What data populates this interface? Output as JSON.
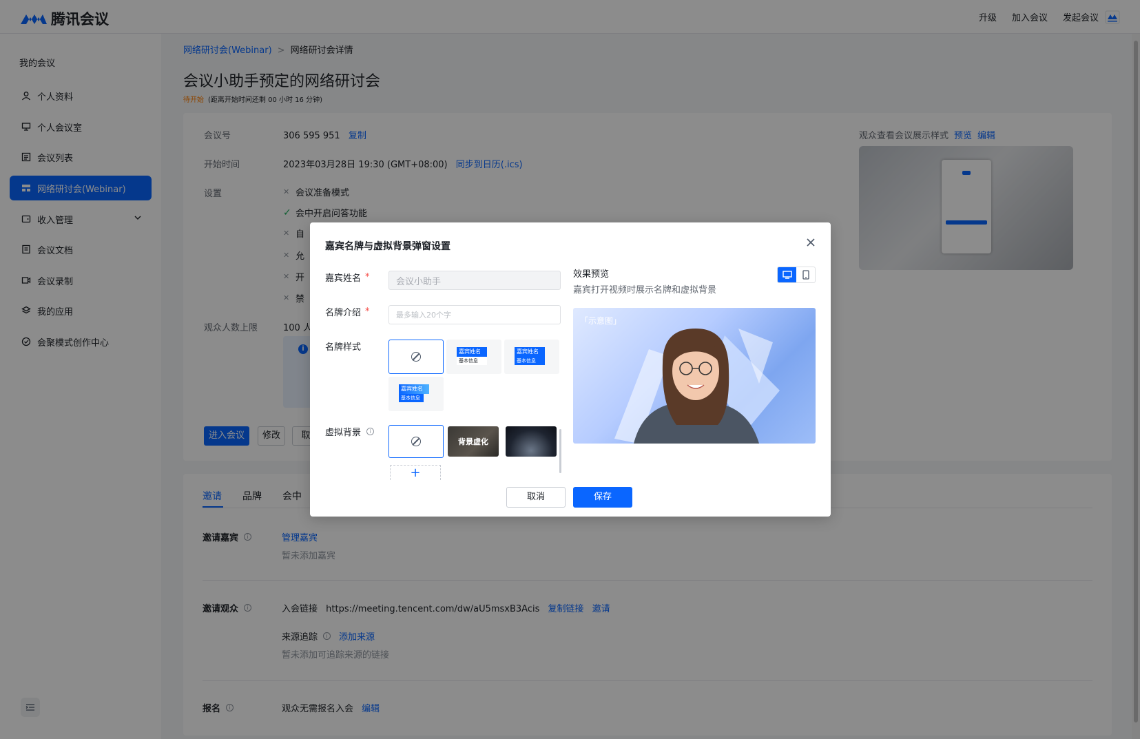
{
  "app": {
    "title": "腾讯会议",
    "nav": [
      "升级",
      "加入会议",
      "发起会议"
    ]
  },
  "sidebar": {
    "title": "我的会议",
    "items": [
      {
        "label": "个人资料",
        "icon": "user-icon"
      },
      {
        "label": "个人会议室",
        "icon": "meeting-room-icon"
      },
      {
        "label": "会议列表",
        "icon": "list-icon"
      },
      {
        "label": "网络研讨会(Webinar)",
        "icon": "webinar-icon",
        "active": true
      },
      {
        "label": "收入管理",
        "icon": "wallet-icon"
      },
      {
        "label": "会议文档",
        "icon": "document-icon"
      },
      {
        "label": "会议录制",
        "icon": "record-icon"
      },
      {
        "label": "我的应用",
        "icon": "apps-icon"
      },
      {
        "label": "会聚模式创作中心",
        "icon": "creation-icon"
      }
    ]
  },
  "breadcrumb": {
    "parent": "网络研讨会(Webinar)",
    "sep": ">",
    "current": "网络研讨会详情"
  },
  "meeting": {
    "title": "会议小助手预定的网络研讨会",
    "status": "待开始",
    "countdown": "(距离开始时间还剩 00 小时 16 分钟)",
    "id_label": "会议号",
    "id_value": "306 595 951",
    "copy_label": "复制",
    "start_label": "开始时间",
    "start_value": "2023年03月28日 19:30 (GMT+08:00)",
    "sync_label": "同步到日历(.ics)",
    "settings_label": "设置",
    "settings": [
      {
        "text": "会议准备模式",
        "on": false
      },
      {
        "text": "会中开启问答功能",
        "on": true
      },
      {
        "text": "自",
        "on": false
      },
      {
        "text": "允",
        "on": false
      },
      {
        "text": "开",
        "on": false
      },
      {
        "text": "禁",
        "on": false
      }
    ],
    "capacity_label": "观众人数上限",
    "capacity_value": "100 人",
    "buttons": {
      "enter": "进入会议",
      "edit": "修改",
      "cancel": "取"
    },
    "preview_label": "观众查看会议展示样式",
    "preview_link": "预览",
    "preview_edit": "编辑"
  },
  "tabs": [
    "邀请",
    "品牌",
    "会中"
  ],
  "invite": {
    "guests_title": "邀请嘉宾",
    "manage_guests": "管理嘉宾",
    "no_guests": "暂未添加嘉宾",
    "audience_title": "邀请观众",
    "link_label": "入会链接",
    "link_value": "https://meeting.tencent.com/dw/aU5msxB3Acis",
    "copy_link": "复制链接",
    "invite_link": "邀请",
    "source_label": "来源追踪",
    "add_source": "添加来源",
    "no_source": "暂未添加可追踪来源的链接",
    "signup_title": "报名",
    "signup_value": "观众无需报名入会",
    "signup_edit": "编辑"
  },
  "modal": {
    "title": "嘉宾名牌与虚拟背景弹窗设置",
    "name_label": "嘉宾姓名",
    "name_value": "会议小助手",
    "intro_label": "名牌介绍",
    "intro_placeholder": "最多输入20个字",
    "style_label": "名牌样式",
    "plate_name": "嘉宾姓名",
    "plate_info": "基本信息",
    "bg_label": "虚拟背景",
    "bg_blur": "背景虚化",
    "preview_title": "效果预览",
    "preview_desc": "嘉宾打开视频时展示名牌和虚拟背景",
    "preview_tag": "「示意图」",
    "cancel": "取消",
    "save": "保存"
  },
  "colors": {
    "accent": "#0a66ff",
    "status": "#ff7d00"
  }
}
